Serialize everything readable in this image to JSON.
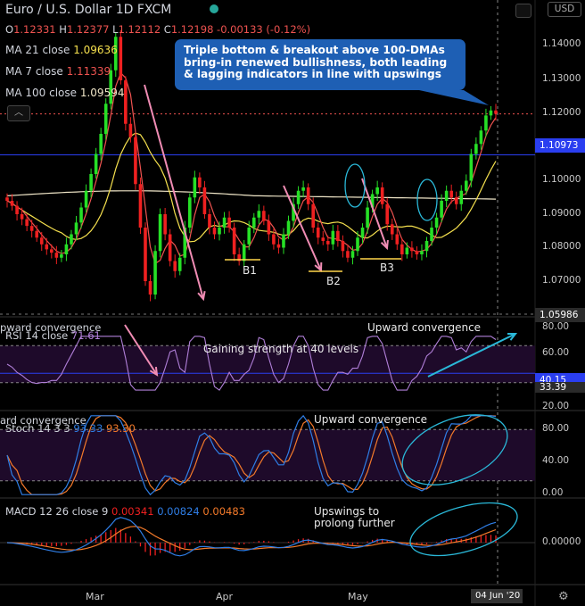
{
  "header": {
    "title": "Euro / U.S. Dollar  1D  FXCM",
    "ohlc": {
      "o_label": "O",
      "o": "1.12331",
      "h_label": "H",
      "h": "1.12377",
      "l_label": "L",
      "l": "1.12112",
      "c_label": "C",
      "c": "1.12198",
      "chg": "-0.00133 (-0.12%)"
    },
    "ma21": {
      "label": "MA 21 close",
      "value": "1.09636",
      "color": "#f5e04e"
    },
    "ma7": {
      "label": "MA 7 close",
      "value": "1.11339",
      "color": "#ef5350"
    },
    "ma100": {
      "label": "MA 100 close",
      "value": "1.09594",
      "color": "#f0e6c8"
    },
    "currency_badge": "USD"
  },
  "callout": "Triple bottom & breakout above 100-DMAs bring-in renewed bullishness, both leading & lagging indicators in line with upswings",
  "annotations": {
    "b1": "B1",
    "b2": "B2",
    "b3": "B3",
    "rsi_note": "Gaining strength at 40 levels",
    "rsi_conv": "Upward convergence",
    "stoch_conv": "Upward convergence",
    "macd_note_1": "Upswings to",
    "macd_note_2": "prolong further"
  },
  "price_axis": {
    "ticks": [
      "1.14000",
      "1.13000",
      "1.12000",
      "1.10000",
      "1.09000",
      "1.08000",
      "1.07000"
    ],
    "level_tag": "1.10973",
    "cursor_tag": "1.05986"
  },
  "rsi_pane": {
    "title_prefix": "pward convergence",
    "title": "RSI 14 close",
    "value": "71.61",
    "ticks": [
      "80.00",
      "60.00",
      "20.00"
    ],
    "tag1": "40.15",
    "tag2": "33.39"
  },
  "stoch_pane": {
    "title_prefix": "ard convergence",
    "title": "Stoch 14 3 3",
    "k": "93.33",
    "d": "93.30",
    "ticks": [
      "80.00",
      "40.00",
      "0.00"
    ]
  },
  "macd_pane": {
    "title": "MACD 12 26 close 9",
    "macd": "0.00341",
    "signal": "0.00824",
    "hist": "0.00483",
    "ticks": [
      "0.00000"
    ]
  },
  "x_axis": {
    "labels": [
      "Mar",
      "Apr",
      "May"
    ],
    "date_tag": "04 Jun '20"
  },
  "colors": {
    "up": "#26e026",
    "down": "#ef2020",
    "ma7": "#ef5350",
    "ma21": "#f5e04e",
    "ma100": "#f0e6c8",
    "rsi": "#b07fd8",
    "stoch_k": "#2f7ee6",
    "stoch_d": "#f47a2a",
    "macd": "#2f7ee6",
    "signal": "#f47a2a",
    "level": "#2a3ef0",
    "cyan": "#2ab8d8"
  },
  "chart_data": {
    "type": "candlestick",
    "ylim": [
      1.064,
      1.148
    ],
    "closes": [
      1.096,
      1.0945,
      1.092,
      1.0905,
      1.0885,
      1.087,
      1.085,
      1.083,
      1.0815,
      1.0805,
      1.079,
      1.08,
      1.083,
      1.086,
      1.0895,
      1.094,
      1.099,
      1.104,
      1.11,
      1.116,
      1.125,
      1.135,
      1.145,
      1.132,
      1.119,
      1.115,
      1.101,
      1.088,
      1.072,
      1.068,
      1.081,
      1.092,
      1.086,
      1.078,
      1.075,
      1.079,
      1.088,
      1.097,
      1.103,
      1.1,
      1.092,
      1.088,
      1.086,
      1.088,
      1.091,
      1.088,
      1.08,
      1.078,
      1.083,
      1.088,
      1.091,
      1.093,
      1.09,
      1.086,
      1.083,
      1.082,
      1.086,
      1.09,
      1.095,
      1.099,
      1.1,
      1.095,
      1.088,
      1.085,
      1.084,
      1.083,
      1.087,
      1.084,
      1.081,
      1.079,
      1.081,
      1.085,
      1.088,
      1.094,
      1.098,
      1.1,
      1.095,
      1.089,
      1.086,
      1.083,
      1.08,
      1.082,
      1.081,
      1.08,
      1.081,
      1.084,
      1.088,
      1.091,
      1.096,
      1.099,
      1.097,
      1.095,
      1.099,
      1.102,
      1.11,
      1.113,
      1.117,
      1.1215,
      1.123,
      1.122
    ]
  }
}
